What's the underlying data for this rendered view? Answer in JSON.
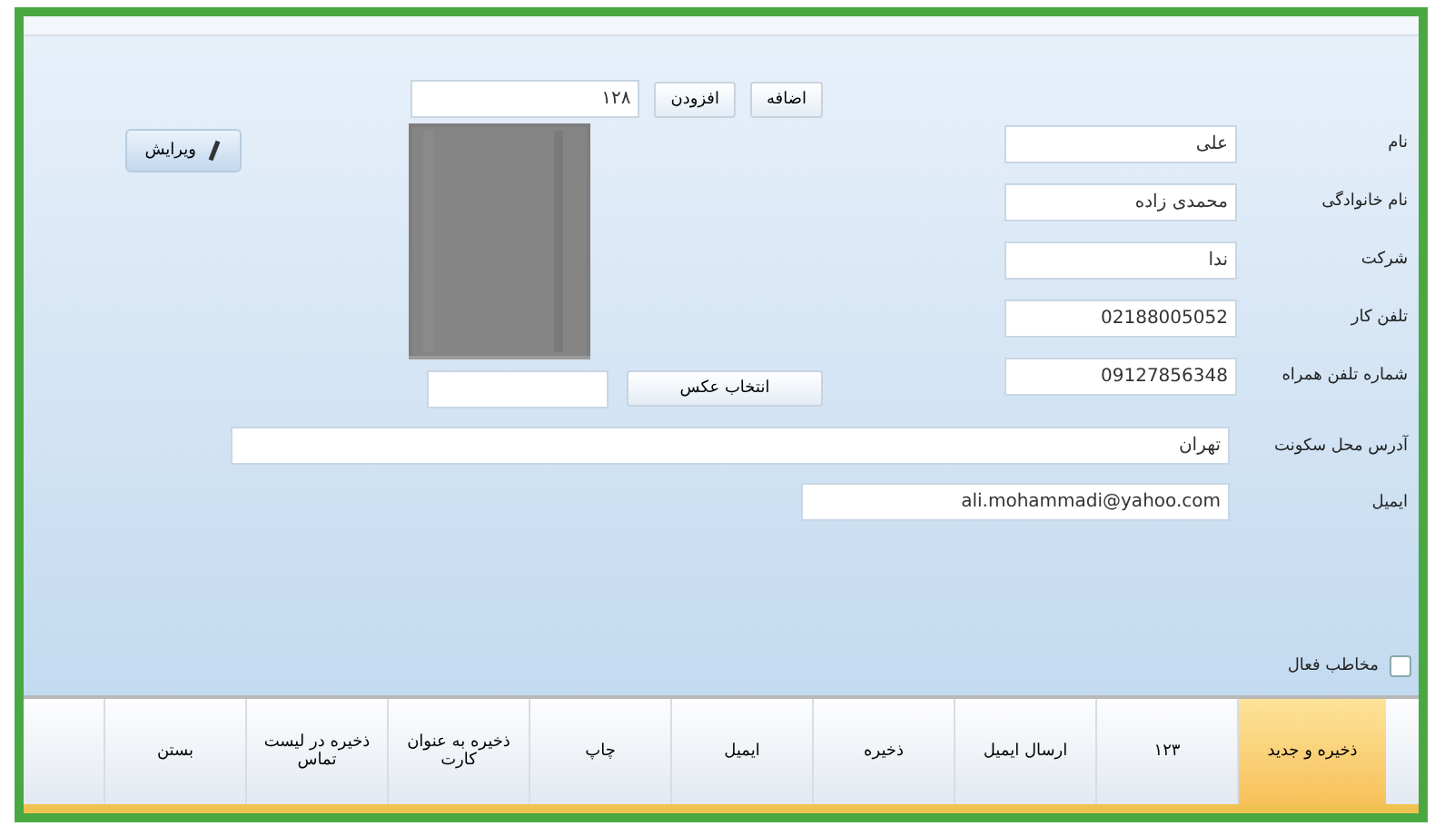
{
  "top_bar": {
    "field_value": "۱۲۸",
    "buttons": [
      "اضافه",
      "افزودن"
    ]
  },
  "edit_button": {
    "label": "ویرایش"
  },
  "photo": {
    "kind": "picture",
    "button": "انتخاب عکس"
  },
  "fields": [
    {
      "label": "نام",
      "value": "علی"
    },
    {
      "label": "نام خانوادگی",
      "value": "محمدی زاده"
    },
    {
      "label": "شرکت",
      "value": "ندا"
    },
    {
      "label": "تلفن کار",
      "value": "02188005052"
    },
    {
      "label": "شماره تلفن همراه",
      "value": "09127856348"
    }
  ],
  "address": {
    "label": "آدرس محل سکونت",
    "value": "تهران"
  },
  "email": {
    "label": "ایمیل",
    "value": "ali.mohammadi@yahoo.com"
  },
  "checkbox": {
    "label": "مخاطب فعال",
    "checked": false
  },
  "ribbon": [
    {
      "label": "ذخیره و جدید",
      "selected": true
    },
    {
      "label": "۱۲۳",
      "selected": false
    },
    {
      "label": "ارسال ایمیل",
      "selected": false
    },
    {
      "label": "ذخیره",
      "selected": false
    },
    {
      "label": "ایمیل",
      "selected": false
    },
    {
      "label": "چاپ",
      "selected": false
    },
    {
      "label": "ذخیره به عنوان کارت",
      "selected": false
    },
    {
      "label": "ذخیره در لیست تماس",
      "selected": false
    },
    {
      "label": "بستن",
      "selected": false
    }
  ]
}
